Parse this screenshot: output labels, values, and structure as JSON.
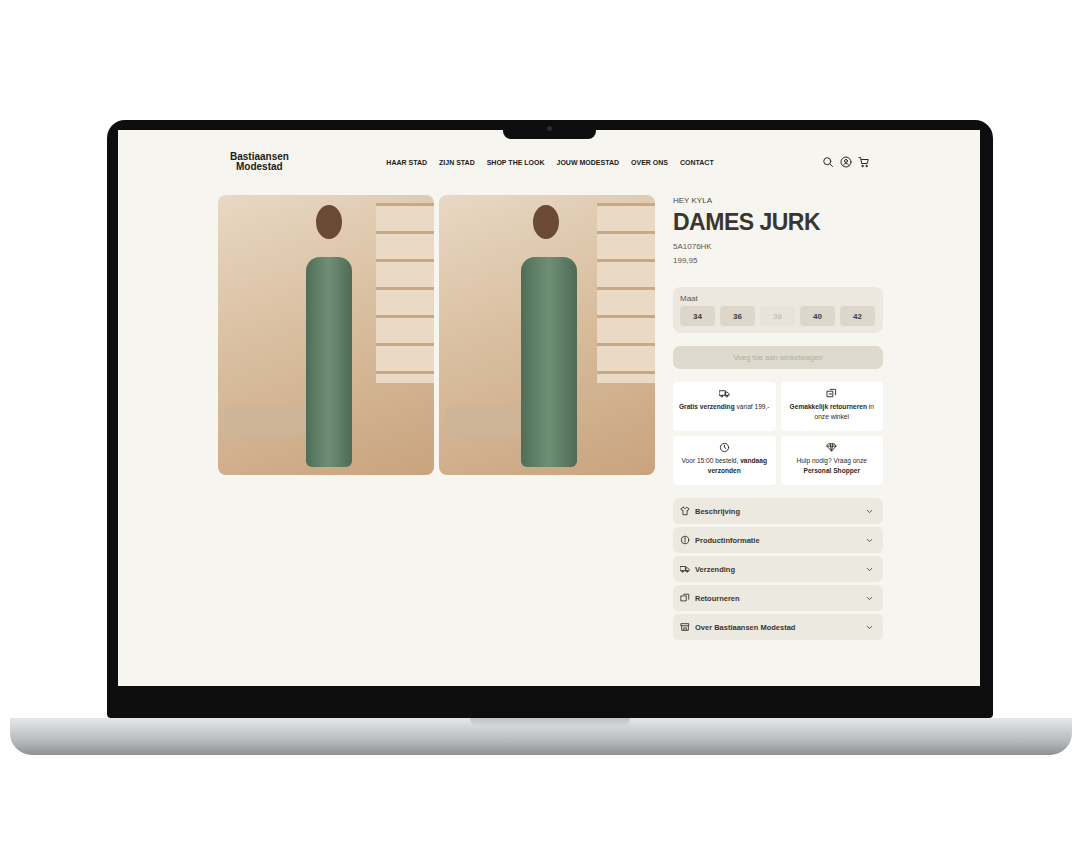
{
  "logo": {
    "lines": [
      "Bastiaansen",
      "Modestad"
    ]
  },
  "nav": [
    "HAAR STAD",
    "ZIJN STAD",
    "SHOP THE LOOK",
    "JOUW MODESTAD",
    "OVER ONS",
    "CONTACT"
  ],
  "product": {
    "brand": "HEY KYLA",
    "title": "DAMES JURK",
    "sku": "5A1076HK",
    "price": "199,95"
  },
  "size": {
    "label": "Maat",
    "options": [
      {
        "label": "34",
        "disabled": false
      },
      {
        "label": "36",
        "disabled": false
      },
      {
        "label": "38",
        "disabled": true
      },
      {
        "label": "40",
        "disabled": false
      },
      {
        "label": "42",
        "disabled": false
      }
    ]
  },
  "add_button": {
    "label": "Voeg toe aan winkelwagen",
    "disabled": true
  },
  "features": [
    {
      "parts": [
        {
          "text": "Gratis verzending",
          "bold": true
        },
        {
          "text": " vanaf 199,-",
          "bold": false
        }
      ]
    },
    {
      "parts": [
        {
          "text": "Gemakkelijk retourneren",
          "bold": true
        },
        {
          "text": " in onze winkel",
          "bold": false
        }
      ]
    },
    {
      "parts": [
        {
          "text": "Voor 15:00 besteld, ",
          "bold": false
        },
        {
          "text": "vandaag verzonden",
          "bold": true
        }
      ]
    },
    {
      "parts": [
        {
          "text": "Hulp nodig? Vraag onze ",
          "bold": false
        },
        {
          "text": "Personal Shopper",
          "bold": true
        }
      ]
    }
  ],
  "accordion": [
    {
      "label": "Beschrijving",
      "expanded": false
    },
    {
      "label": "Productinformatie",
      "expanded": false
    },
    {
      "label": "Verzending",
      "expanded": false
    },
    {
      "label": "Retourneren",
      "expanded": false
    },
    {
      "label": "Over Bastiaansen Modestad",
      "expanded": false
    }
  ]
}
